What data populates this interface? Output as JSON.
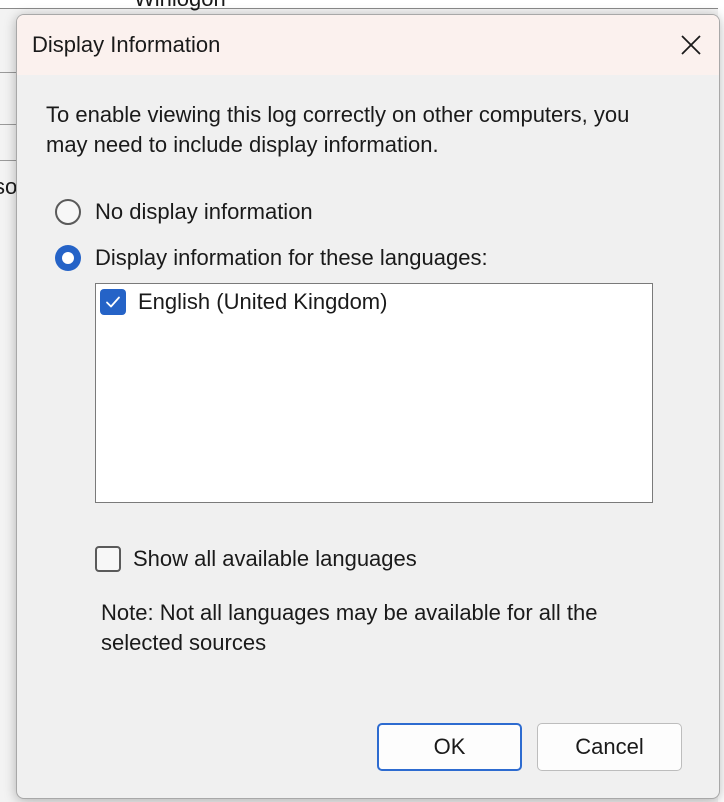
{
  "background": {
    "top_text": "Winlogon",
    "side_text": "so"
  },
  "dialog": {
    "title": "Display Information",
    "intro": "To enable viewing this log correctly on other computers, you may need to include display information.",
    "options": {
      "no_display": {
        "label": "No display information",
        "selected": false
      },
      "languages": {
        "label": "Display information for these languages:",
        "selected": true
      }
    },
    "language_list": [
      {
        "label": "English (United Kingdom)",
        "checked": true
      }
    ],
    "show_all": {
      "label": "Show all available languages",
      "checked": false
    },
    "note": "Note: Not all languages may be available for all the selected sources",
    "buttons": {
      "ok": "OK",
      "cancel": "Cancel"
    }
  },
  "icons": {
    "close": "close-icon",
    "check": "checkmark-icon"
  },
  "colors": {
    "accent": "#2563c7",
    "title_bar": "#fbf1ee",
    "dialog_bg": "#f0f0f0"
  }
}
